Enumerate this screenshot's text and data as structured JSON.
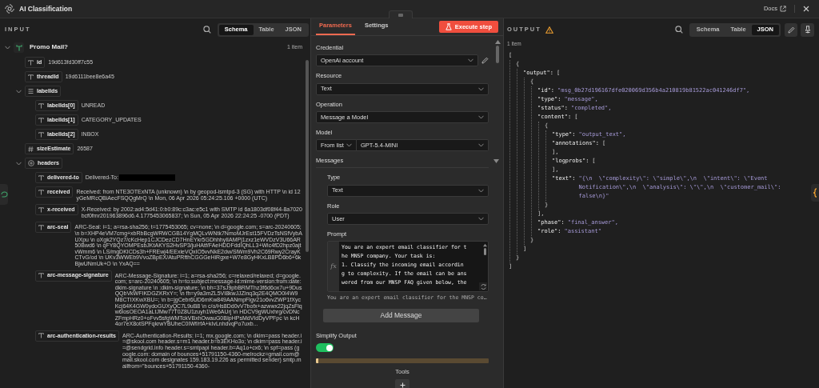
{
  "header": {
    "title": "AI Classification",
    "docs_link": "Docs"
  },
  "input": {
    "title": "INPUT",
    "view_tabs": [
      {
        "label": "Schema",
        "selected": true
      },
      {
        "label": "Table",
        "selected": false
      },
      {
        "label": "JSON",
        "selected": false
      }
    ],
    "tree": {
      "label": "Promo Mail?",
      "count": "1 item",
      "expanded": true,
      "children": [
        {
          "kind": "string",
          "key": "id",
          "value": "19d613fd30ff7c55"
        },
        {
          "kind": "string",
          "key": "threadId",
          "value": "19d6111bee8e6a45"
        },
        {
          "kind": "array",
          "key": "labelIds",
          "expanded": true,
          "children": [
            {
              "kind": "string",
              "key": "labelIds[0]",
              "value": "UNREAD"
            },
            {
              "kind": "string",
              "key": "labelIds[1]",
              "value": "CATEGORY_UPDATES"
            },
            {
              "kind": "string",
              "key": "labelIds[2]",
              "value": "INBOX"
            }
          ]
        },
        {
          "kind": "number",
          "key": "sizeEstimate",
          "value": "26587"
        },
        {
          "kind": "object",
          "key": "headers",
          "expanded": true,
          "children": [
            {
              "kind": "string",
              "key": "delivered-to",
              "value": "Delivered-To:",
              "redacted": true
            },
            {
              "kind": "string",
              "key": "received",
              "value": "Received: from NTE3OTExNTA (unknown) \\n by geopod-ismtpd-3 (SG) with HTTP \\n id 12yGeMRcQBiAecFSQQgMrQ \\n Mon, 06 Apr 2026 05:24:25.106 +0000 (UTC)"
            },
            {
              "kind": "string",
              "key": "x-received",
              "value": "X-Received: by 2002:ad4:5d41:0:b0:89c:c3ac:e5c1 with SMTP id 6a1803df08f44-8a7020bcf0fmr201963896d6.4.1775453065837; \\n Sun, 05 Apr 2026 22:24:25 -0700 (PDT)"
            },
            {
              "kind": "string",
              "key": "arc-seal",
              "value": "ARC-Seal: i=1; a=rsa-sha256; t=1775453065; cv=none; \\n d=google.com; s=arc-20240605; \\n b=XHP4eVM7cmg+xbRbBcgWRWCGB14YgMQLvWNtk7NmoMJrEst15FVDzTsNSfVybAUXpu \\n oXgk2YQz7/cKcHep1CJCDezCD7HnEYkr5GDhhhyIIAMPj1zxz1eWVDzV3U66AR50Bwd6 \\n qFY8QYOMPEsbJKtAKYS2HvSP3/juHAtf/FAeHDDFddIQhLL3+Wic4fD2hpz0ajtvWmm6 \\n LS/mgDKICDs3h+FREwj4/EExieVQxIO5vvNkE2dw/SiWm9Vh2C69Rwy2CrayKCTvG/od \\n UKv3WWEb9VvoZBpEX/AtuPRfthCGGGeHiRgxe+W7e8GyHKxLB8PD6b6+6kBjwUNmUk+O \\n YxAQ=="
            },
            {
              "kind": "string",
              "key": "arc-message-signature",
              "value": "ARC-Message-Signature: i=1; a=rsa-sha256; c=relaxed/relaxed; d=google.com; s=arc-20240605; \\n h=to:subject:message-id:mime-version:from:date:dkim-signature \\n :dkim-signature; \\n bh=37sJ9pbBRMThz3f6d6ox7u+9DusQQbVkWFIKDGZKRxY=; \\n fh=y9a3mZL5VI8kwJJZlnq3q2E4QMO0I4W9M8CTIXKwXBU=; \\n b=jgCebr6UD6mKw849AANmpFlgv21o6vvZWP1fXycKcj64K4GW0ydoGUXyQC7L9uB8 \\n c/o/Hs8Dd0vV7bofx+azwwx22jqZsFlqw6losOEOA1aLtJMw77T0Z8U1zuyh1We6AUrj \\n HDCV9gWUxhrg/cvDNcZFmpHRz0+oFvv5sfgWMTckVBxhOwauG0BIpHPsMdVIdDyVPFpc \\n kcH4or7eX8otSPFqkrwYBUheC0IWf/rfA+kIvLnhdvqPo7uxb..."
            },
            {
              "kind": "string",
              "key": "arc-authentication-results",
              "value": "ARC-Authentication-Results: i=1; mx.google.com; \\n dkim=pass header.i=@skool.com header.s=m1 header.b=b3EKHo3o; \\n dkim=pass header.i=@sendgrid.info header.s=smtpapi header.b=Aq1o+cx6; \\n spf=pass (google.com: domain of bounces+51791150-4360-melrockz=gmail.com@mail.skool.com designates 159.183.19.226 as permitted sender) smtp.mailfrom=\"bounces+51791150-4360-"
            }
          ]
        }
      ]
    }
  },
  "parameters": {
    "tabs": [
      {
        "label": "Parameters",
        "selected": true
      },
      {
        "label": "Settings",
        "selected": false
      }
    ],
    "execute_button": "Execute step",
    "fields": [
      {
        "kind": "credential",
        "label": "Credential",
        "value": "OpenAi account"
      },
      {
        "kind": "select",
        "label": "Resource",
        "value": "Text"
      },
      {
        "kind": "select",
        "label": "Operation",
        "value": "Message a Model"
      },
      {
        "kind": "model",
        "label": "Model",
        "mode": "From list",
        "value": "GPT-5.4-MINI"
      }
    ],
    "messages": {
      "label": "Messages",
      "fields": [
        {
          "kind": "select",
          "label": "Type",
          "value": "Text"
        },
        {
          "kind": "select",
          "label": "Role",
          "value": "User"
        }
      ],
      "prompt": {
        "label": "Prompt",
        "gutter_marker": "fx",
        "lines": [
          "You are an expert email classifier for t",
          "he MNSP company. Your task is:",
          "1. Classify the incoming email accordin",
          "g to complexity. If the email can be ans",
          "wered from our MNSP FAQ given below, the"
        ],
        "hint": "You are an expert email classifier for the MNSP co…"
      },
      "add_button": "Add Message"
    },
    "simplify_output": {
      "label": "Simplify Output",
      "on": true
    },
    "tools": {
      "label": "Tools"
    }
  },
  "output": {
    "title": "OUTPUT",
    "warning": true,
    "view_tabs": [
      {
        "label": "Schema",
        "selected": false
      },
      {
        "label": "Table",
        "selected": false
      },
      {
        "label": "JSON",
        "selected": true
      }
    ],
    "count": "1 item",
    "json": {
      "value": "[",
      "close": "]",
      "children": [
        {
          "value": "{",
          "close": "}",
          "children": [
            {
              "key": "\"output\":",
              "value": "[",
              "close": "]",
              "children": [
                {
                  "value": "{",
                  "close": "}",
                  "children": [
                    {
                      "key": "\"id\":",
                      "value": "\"msg_0b27d196167dfe020069d356b4a210819b81522ac041246df7\","
                    },
                    {
                      "key": "\"type\":",
                      "value": "\"message\","
                    },
                    {
                      "key": "\"status\":",
                      "value": "\"completed\","
                    },
                    {
                      "key": "\"content\":",
                      "value": "[",
                      "close": "],",
                      "children": [
                        {
                          "value": "{",
                          "close": "}",
                          "children": [
                            {
                              "key": "\"type\":",
                              "value": "\"output_text\","
                            },
                            {
                              "key": "\"annotations\":",
                              "value": "[",
                              "close": "],"
                            },
                            {
                              "key": "\"logprobs\":",
                              "value": "[",
                              "close": "],"
                            },
                            {
                              "key": "\"text\":",
                              "value": "\"{\\n  \\\"complexity\\\": \\\"simple\\\",\\n  \\\"intent\\\": \\\"Event Notification\\\",\\n  \\\"analysis\\\": \\\"\\\",\\n  \\\"customer_mail\\\": false\\n}\""
                            }
                          ]
                        }
                      ]
                    },
                    {
                      "key": "\"phase\":",
                      "value": "\"final_answer\","
                    },
                    {
                      "key": "\"role\":",
                      "value": "\"assistant\""
                    }
                  ]
                }
              ]
            }
          ]
        }
      ]
    }
  }
}
